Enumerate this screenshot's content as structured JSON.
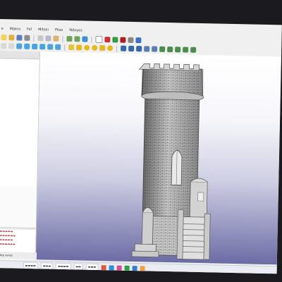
{
  "menubar": {
    "items": [
      "e",
      "Makro",
      "Fel",
      "Mitsei",
      "Pilas",
      "Ndxyes"
    ]
  },
  "status": {
    "bottom_left": "inday seres"
  },
  "colors": {
    "viewport_top": "#ffffff",
    "viewport_bottom": "#6c6ca6",
    "report_text": "#c04848",
    "model_light": "#d9d9d9",
    "model_dark": "#8a8a8a"
  },
  "icons": {
    "toolbar1": [
      "new-icon",
      "open-icon",
      "save-icon",
      "print-icon",
      "cut-icon",
      "copy-icon",
      "paste-icon",
      "undo-icon",
      "redo-icon",
      "refresh-icon",
      "pointer-icon",
      "macro-icon",
      "play-icon",
      "stop-icon",
      "debug-icon",
      "help-icon"
    ],
    "toolbar2": [
      "view-fit-icon",
      "view-iso-icon",
      "view-front-icon",
      "view-top-icon",
      "view-right-icon",
      "view-rear-icon",
      "view-bottom-icon",
      "view-left-icon",
      "measure-icon",
      "cube-icon",
      "cylinder-icon",
      "sphere-icon",
      "cone-icon",
      "torus-icon",
      "union-icon",
      "cut-icon",
      "intersection-icon",
      "fillet-icon",
      "chamfer-icon",
      "extrude-icon",
      "revolve-icon",
      "mirror-icon",
      "sweep-icon",
      "loft-icon"
    ]
  }
}
